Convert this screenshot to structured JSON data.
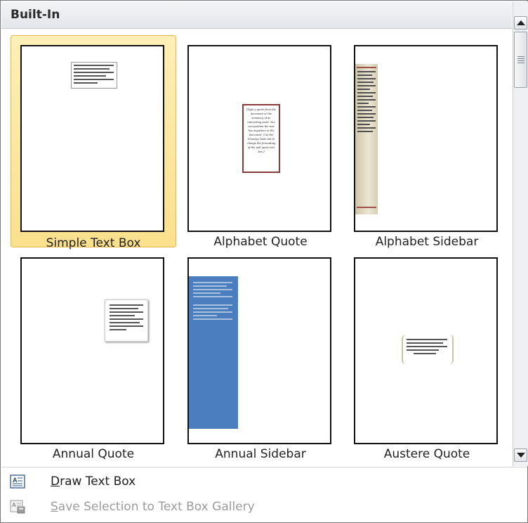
{
  "header": {
    "title": "Built-In"
  },
  "tiles": [
    {
      "label": "Simple Text Box",
      "selected": true
    },
    {
      "label": "Alphabet Quote",
      "selected": false,
      "quote_text": "[Type a quote from the document or the summary of an interesting point. You can position the text box anywhere in the document. Use the Drawing Tools tab to change the formatting of the pull quote text box.]"
    },
    {
      "label": "Alphabet Sidebar",
      "selected": false
    },
    {
      "label": "Annual Quote",
      "selected": false
    },
    {
      "label": "Annual Sidebar",
      "selected": false
    },
    {
      "label": "Austere Quote",
      "selected": false
    }
  ],
  "menu": {
    "draw": {
      "mnemonic": "D",
      "rest": "raw Text Box",
      "icon": "text-box-icon"
    },
    "save": {
      "mnemonic": "S",
      "rest": "ave Selection to Text Box Gallery",
      "icon": "save-to-gallery-icon",
      "disabled": true
    }
  },
  "scrollbar": {
    "up_icon": "scroll-up-arrow",
    "down_icon": "scroll-down-arrow"
  },
  "colors": {
    "selection_fill": "#fbe08d",
    "selection_border": "#e6b84c",
    "sidebar_blue": "#4a7ebf",
    "quote_border": "#8b3a3a"
  }
}
